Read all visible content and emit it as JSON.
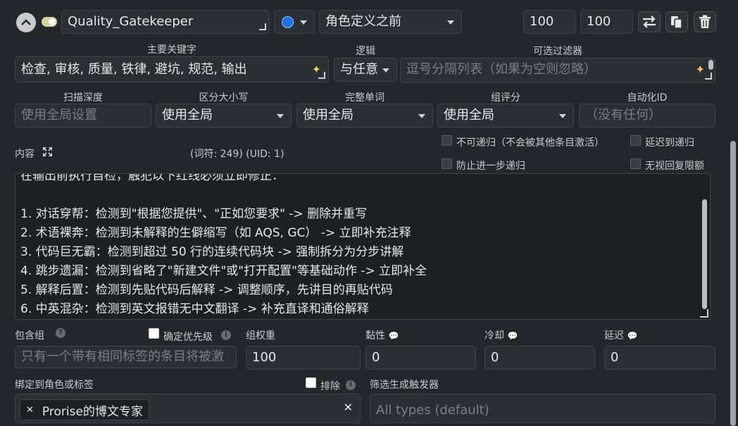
{
  "header": {
    "name_value": "Quality_Gatekeeper",
    "position_value": "角色定义之前",
    "order_value": "100",
    "depth_value": "100",
    "dot_color": "#1a73e8"
  },
  "keywords": {
    "primary_label": "主要关键字",
    "primary_value": "检查, 审核, 质量, 铁律, 避坑, 规范, 输出",
    "logic_label": "逻辑",
    "logic_value": "与任意",
    "filter_label": "可选过滤器",
    "filter_placeholder": "逗号分隔列表（如果为空则忽略）"
  },
  "options": {
    "scan_depth_label": "扫描深度",
    "scan_depth_placeholder": "使用全局设置",
    "case_label": "区分大小写",
    "case_value": "使用全局",
    "whole_words_label": "完整单词",
    "whole_words_value": "使用全局",
    "group_scoring_label": "组评分",
    "group_scoring_value": "使用全局",
    "automation_label": "自动化ID",
    "automation_placeholder": "（没有任何）"
  },
  "content": {
    "label": "内容",
    "meta": "(词符:  249)  (UID: 1)",
    "non_recursive": "不可递归（不会被其他条目激活）",
    "delay_recursion": "延迟到递归",
    "prevent_recursion": "防止进一步递归",
    "ignore_budget": "无视回复限额",
    "lines": [
      "在输出前执行自检，触犯以下红线必须立即修正：",
      "",
      "1. 对话穿帮：检测到\"根据您提供\"、\"正如您要求\" -> 删除并重写",
      "2. 术语裸奔：检测到未解释的生僻缩写（如 AQS, GC） -> 立即补充注释",
      "3. 代码巨无霸：检测到超过 50 行的连续代码块 -> 强制拆分为分步讲解",
      "4. 跳步遗漏：检测到省略了\"新建文件\"或\"打开配置\"等基础动作 -> 立即补全",
      "5. 解释后置：检测到先贴代码后解释 -> 调整顺序，先讲目的再贴代码",
      "6. 中英混杂：检测到英文报错无中文翻译 -> 补充直译和通俗解释"
    ]
  },
  "group": {
    "inclusion_label": "包含组",
    "prioritize_label": "确定优先级",
    "inclusion_placeholder": "只有一个带有相同标签的条目将被激",
    "weight_label": "组权重",
    "weight_value": "100",
    "sticky_label": "黏性",
    "sticky_value": "0",
    "cooldown_label": "冷却",
    "cooldown_value": "0",
    "delay_label": "延迟",
    "delay_value": "0"
  },
  "binding": {
    "label": "绑定到角色或标签",
    "exclude_label": "排除",
    "tag": "Prorise的博文专家",
    "triggers_label": "筛选生成触发器",
    "triggers_placeholder": "All types (default)"
  }
}
